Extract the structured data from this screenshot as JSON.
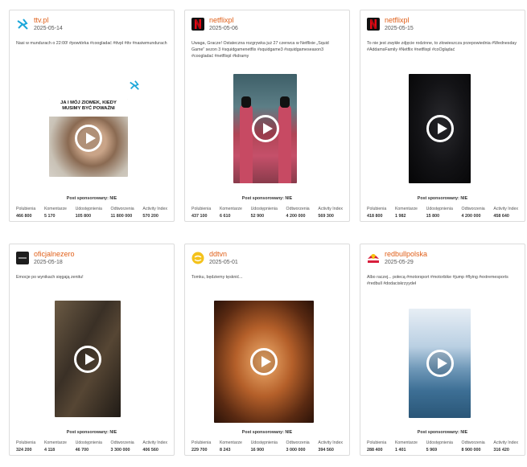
{
  "cards": [
    {
      "name": "ttv.pl",
      "date": "2025-05-14",
      "avatar_icon": "ttv-logo-icon",
      "description": "Nasi w mundurach o 22:00! #powtórka #coogladać #ttvpl #ttv #nasiwmundurach",
      "media_caption": "JA I MÓJ ZIOMEK, KIEDY MUSIMY BYĆ POWAŻNI",
      "sponsored": "Post sponsorowany: NIE",
      "stats": [
        {
          "label": "Polubienia",
          "value": "466 800"
        },
        {
          "label": "Komentarze",
          "value": "5 170"
        },
        {
          "label": "Udostępnienia",
          "value": "105 800"
        },
        {
          "label": "Odtworzenia",
          "value": "11 800 000"
        },
        {
          "label": "Activity Index",
          "value": "570 200"
        }
      ]
    },
    {
      "name": "netflixpl",
      "date": "2025-05-06",
      "avatar_icon": "netflix-logo-icon",
      "description": "Uwaga, Gracze! Ostateczna rozgrywka już 27 czerwca w Netflixie „Squid Game” sezon 3 #squidgamenetflix #squidgame3 #squidgameseason3 #coogladać #netflixpl #kdramy",
      "sponsored": "Post sponsorowany: NIE",
      "stats": [
        {
          "label": "Polubienia",
          "value": "437 100"
        },
        {
          "label": "Komentarze",
          "value": "6 610"
        },
        {
          "label": "Udostępnienia",
          "value": "52 900"
        },
        {
          "label": "Odtworzenia",
          "value": "4 200 000"
        },
        {
          "label": "Activity Index",
          "value": "569 300"
        }
      ]
    },
    {
      "name": "netflixpl",
      "date": "2025-05-15",
      "avatar_icon": "netflix-logo-icon",
      "description": "To nie jest zwykłe zdjęcie rodzinne, to złowieszcza przepowiednia #Wednesday #AddamsFamily #Netflix #netflixpl #coOglądać",
      "sponsored": "Post sponsorowany: NIE",
      "stats": [
        {
          "label": "Polubienia",
          "value": "418 800"
        },
        {
          "label": "Komentarze",
          "value": "1 982"
        },
        {
          "label": "Udostępnienia",
          "value": "15 800"
        },
        {
          "label": "Odtworzenia",
          "value": "4 200 000"
        },
        {
          "label": "Activity Index",
          "value": "458 640"
        }
      ]
    },
    {
      "name": "oficjalnezero",
      "date": "2025-05-18",
      "avatar_icon": "zero-logo-icon",
      "description": "Emocje po wynikach sięgają zenitu!",
      "sponsored": "Post sponsorowany: NIE",
      "stats": [
        {
          "label": "Polubienia",
          "value": "324 200"
        },
        {
          "label": "Komentarze",
          "value": "4 118"
        },
        {
          "label": "Udostępnienia",
          "value": "46 700"
        },
        {
          "label": "Odtworzenia",
          "value": "3 300 000"
        },
        {
          "label": "Activity Index",
          "value": "406 560"
        }
      ]
    },
    {
      "name": "ddtvn",
      "date": "2025-05-01",
      "avatar_icon": "ddtvn-logo-icon",
      "description": "Tomku, będziemy tęsknić...",
      "sponsored": "Post sponsorowany: NIE",
      "stats": [
        {
          "label": "Polubienia",
          "value": "229 700"
        },
        {
          "label": "Komentarze",
          "value": "8 243"
        },
        {
          "label": "Udostępnienia",
          "value": "16 900"
        },
        {
          "label": "Odtworzenia",
          "value": "3 000 000"
        },
        {
          "label": "Activity Index",
          "value": "394 560"
        }
      ]
    },
    {
      "name": "redbullpolska",
      "date": "2025-05-29",
      "avatar_icon": "redbull-logo-icon",
      "description": "Albo raczej... połecą #motorsport #motorbike #jump #flying #extremesports #redbull #dodaciskrzyydeł",
      "sponsored": "Post sponsorowany: NIE",
      "stats": [
        {
          "label": "Polubienia",
          "value": "288 400"
        },
        {
          "label": "Komentarze",
          "value": "1 401"
        },
        {
          "label": "Udostępnienia",
          "value": "5 969"
        },
        {
          "label": "Odtworzenia",
          "value": "8 900 000"
        },
        {
          "label": "Activity Index",
          "value": "316 420"
        }
      ]
    }
  ],
  "colors": {
    "accent": "#e0601a",
    "netflix_red": "#e50914",
    "border": "#dcdcdc"
  }
}
